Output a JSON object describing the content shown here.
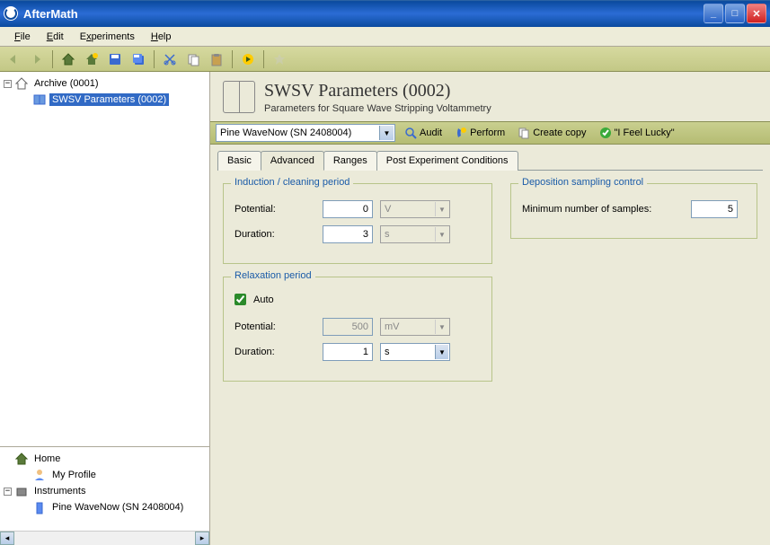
{
  "window": {
    "title": "AfterMath"
  },
  "menu": {
    "file": "File",
    "edit": "Edit",
    "experiments": "Experiments",
    "help": "Help"
  },
  "tree": {
    "archive": "Archive (0001)",
    "archive_child": "SWSV Parameters (0002)",
    "home": "Home",
    "profile": "My Profile",
    "instruments": "Instruments",
    "instrument_child": "Pine WaveNow (SN 2408004)"
  },
  "header": {
    "title": "SWSV Parameters (0002)",
    "subtitle": "Parameters for Square Wave Stripping Voltammetry"
  },
  "actionbar": {
    "device": "Pine WaveNow (SN 2408004)",
    "audit": "Audit",
    "perform": "Perform",
    "copy": "Create copy",
    "lucky": "\"I Feel Lucky\""
  },
  "tabs": {
    "basic": "Basic",
    "advanced": "Advanced",
    "ranges": "Ranges",
    "post": "Post Experiment Conditions"
  },
  "groups": {
    "induction": {
      "legend": "Induction / cleaning period",
      "potential_lbl": "Potential:",
      "potential_val": "0",
      "potential_unit": "V",
      "duration_lbl": "Duration:",
      "duration_val": "3",
      "duration_unit": "s"
    },
    "relaxation": {
      "legend": "Relaxation period",
      "auto_lbl": "Auto",
      "potential_lbl": "Potential:",
      "potential_val": "500",
      "potential_unit": "mV",
      "duration_lbl": "Duration:",
      "duration_val": "1",
      "duration_unit": "s"
    },
    "deposition": {
      "legend": "Deposition sampling control",
      "min_lbl": "Minimum number of samples:",
      "min_val": "5"
    }
  }
}
